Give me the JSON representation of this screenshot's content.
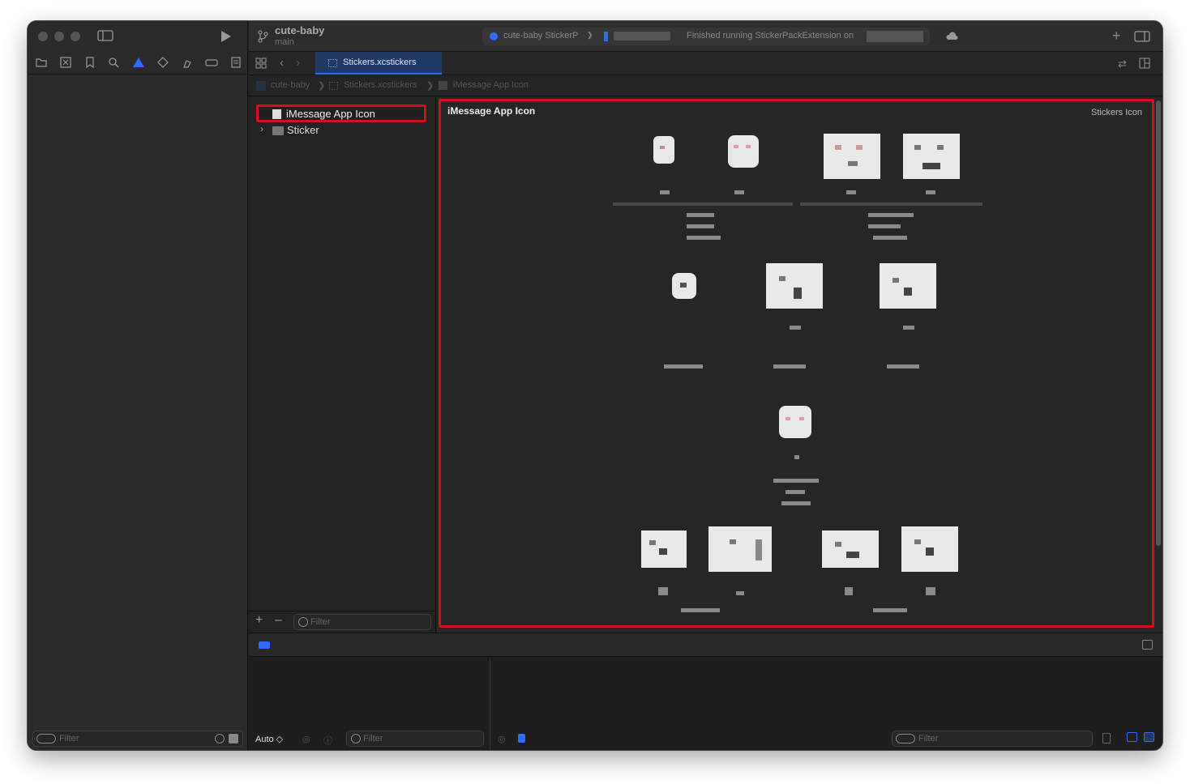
{
  "window": {
    "project_name": "cute-baby",
    "branch": "main"
  },
  "activity": {
    "scheme": "cute-baby StickerP",
    "separator": "❯",
    "status": "Finished running StickerPackExtension on"
  },
  "tab": {
    "label": "Stickers.xcstickers"
  },
  "breadcrumb": {
    "items": [
      "cute-baby",
      "Stickers.xcstickers",
      "iMessage App Icon"
    ],
    "separator": "❯"
  },
  "outline": {
    "items": [
      {
        "label": "iMessage App Icon",
        "selected": true
      },
      {
        "label": "Sticker",
        "selected": false
      }
    ],
    "filter_placeholder": "Filter"
  },
  "editor": {
    "title": "iMessage App Icon",
    "subtitle": "Stickers Icon"
  },
  "navigator": {
    "filter_placeholder": "Filter"
  },
  "debug": {
    "scope_label": "Auto ◇",
    "variables_filter_placeholder": "Filter",
    "console_filter_placeholder": "Filter"
  },
  "colors": {
    "highlight": "#d0101c",
    "accent": "#2f6bff"
  }
}
